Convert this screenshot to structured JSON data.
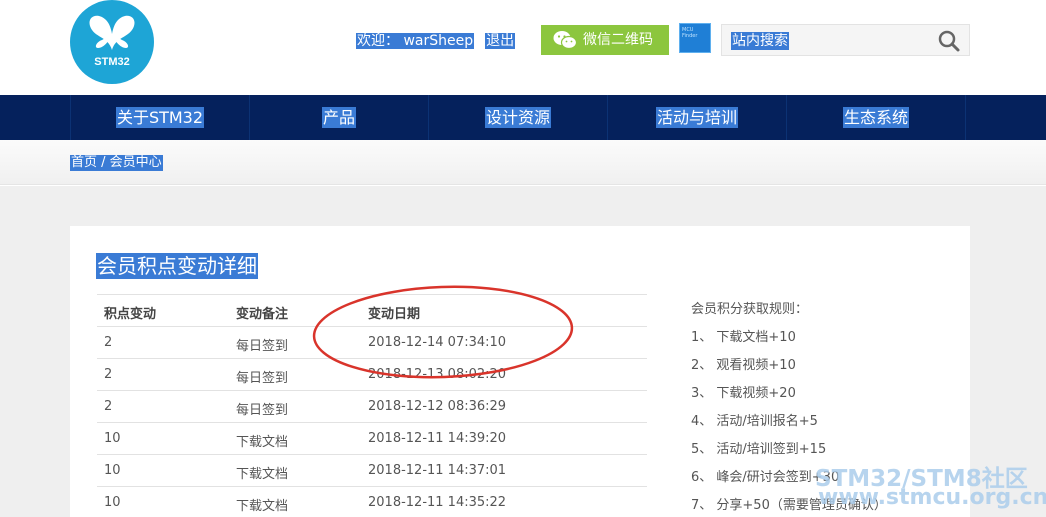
{
  "logo": {
    "text": "STM32"
  },
  "header": {
    "welcome": "欢迎： warSheep",
    "logout": "退出",
    "wechat_button": "微信二维码",
    "search_placeholder": "站内搜索"
  },
  "nav": {
    "items": [
      {
        "label": "关于STM32"
      },
      {
        "label": "产品"
      },
      {
        "label": "设计资源"
      },
      {
        "label": "活动与培训"
      },
      {
        "label": "生态系统"
      }
    ]
  },
  "breadcrumb": "首页 / 会员中心",
  "page_title": "会员积点变动详细",
  "table": {
    "headers": [
      "积点变动",
      "变动备注",
      "变动日期"
    ],
    "rows": [
      [
        "2",
        "每日签到",
        "2018-12-14 07:34:10"
      ],
      [
        "2",
        "每日签到",
        "2018-12-13 08:02:20"
      ],
      [
        "2",
        "每日签到",
        "2018-12-12 08:36:29"
      ],
      [
        "10",
        "下载文档",
        "2018-12-11 14:39:20"
      ],
      [
        "10",
        "下载文档",
        "2018-12-11 14:37:01"
      ],
      [
        "10",
        "下载文档",
        "2018-12-11 14:35:22"
      ]
    ]
  },
  "rules": {
    "title": "会员积分获取规则：",
    "items": [
      "1、 下载文档+10",
      "2、 观看视频+10",
      "3、 下载视频+20",
      "4、 活动/培训报名+5",
      "5、 活动/培训签到+15",
      "6、 峰会/研讨会签到+30",
      "7、 分享+50（需要管理员确认）"
    ]
  },
  "watermark": {
    "line1": "STM32/STM8社区",
    "line2": "www.stmcu.org.cn"
  },
  "colors": {
    "nav_bg": "#05215c",
    "selection": "#3a7bd5",
    "wechat": "#8cc63e",
    "logo": "#1ea5d6",
    "annotation_circle": "#d9342b"
  }
}
